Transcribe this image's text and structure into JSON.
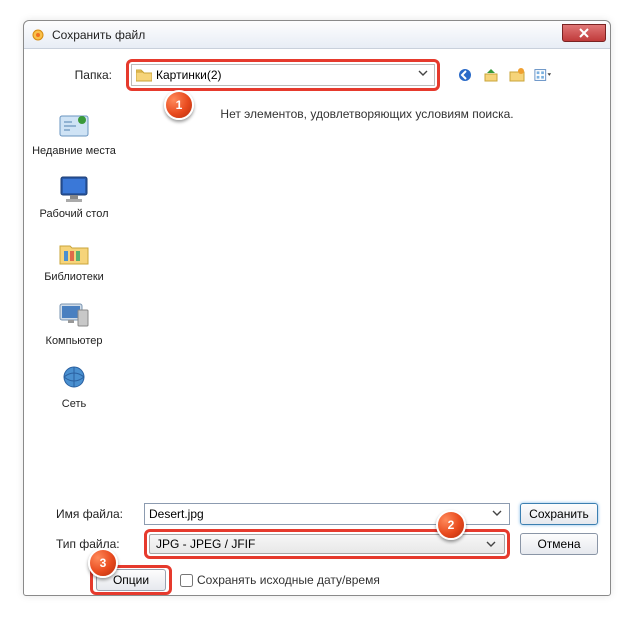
{
  "window": {
    "title": "Сохранить файл"
  },
  "folder": {
    "label": "Папка:",
    "value": "Картинки(2)"
  },
  "filearea": {
    "empty_message": "Нет элементов, удовлетворяющих условиям поиска."
  },
  "places": {
    "recent": "Недавние места",
    "desktop": "Рабочий стол",
    "libraries": "Библиотеки",
    "computer": "Компьютер",
    "network": "Сеть"
  },
  "filename": {
    "label": "Имя файла:",
    "value": "Desert.jpg"
  },
  "filetype": {
    "label": "Тип файла:",
    "value": "JPG - JPEG / JFIF"
  },
  "buttons": {
    "save": "Сохранить",
    "cancel": "Отмена",
    "options": "Опции"
  },
  "checkbox": {
    "label": "Сохранять исходные дату/время",
    "checked": false
  },
  "markers": {
    "m1": "1",
    "m2": "2",
    "m3": "3"
  }
}
